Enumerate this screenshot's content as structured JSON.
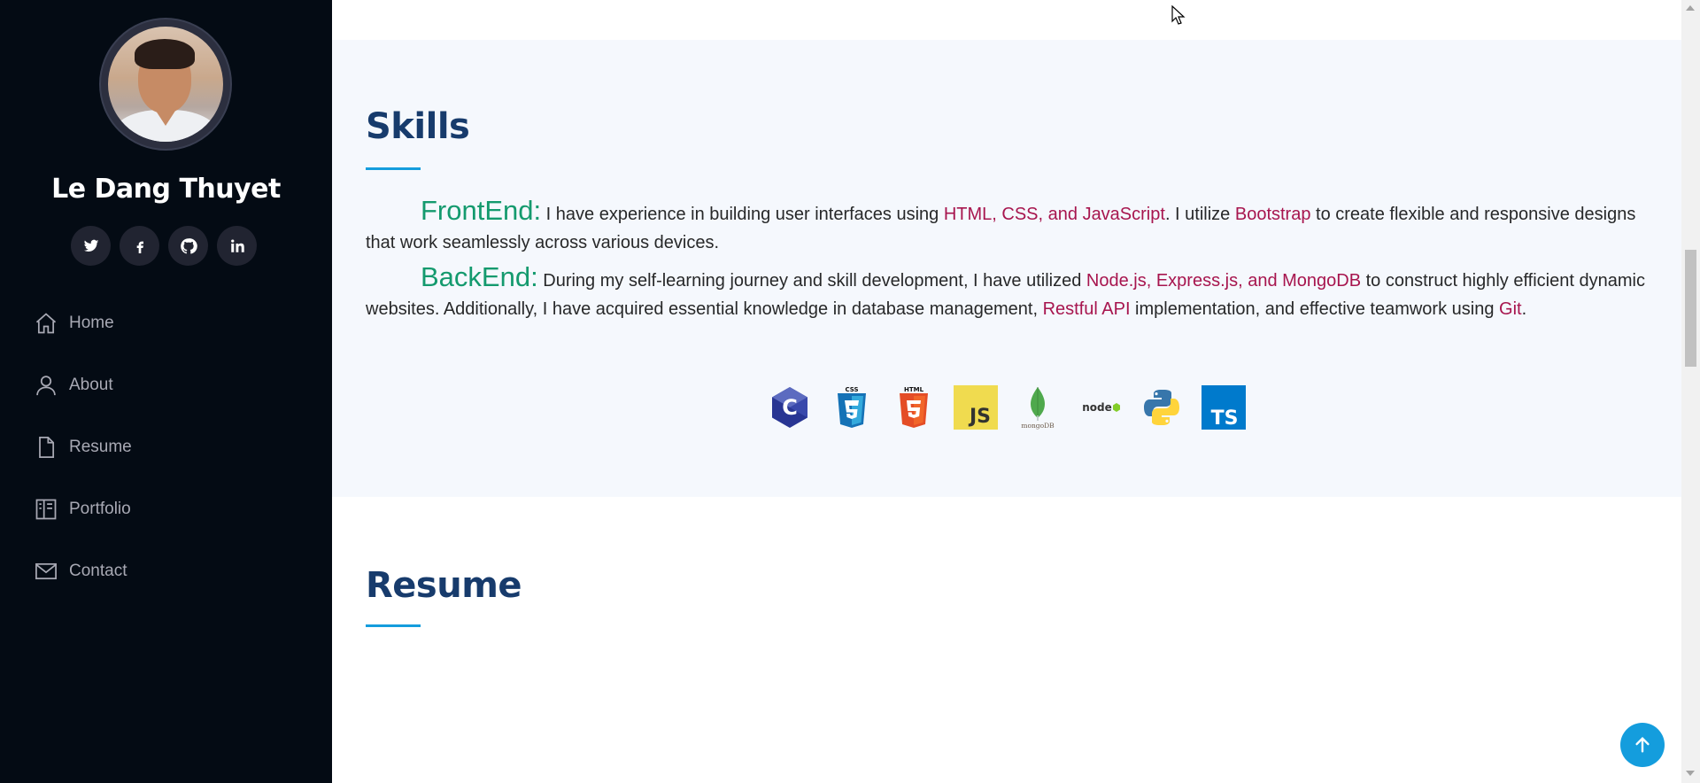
{
  "sidebar": {
    "name": "Le Dang Thuyet",
    "social": [
      {
        "icon": "twitter-icon",
        "glyph": "t"
      },
      {
        "icon": "facebook-icon",
        "glyph": "f"
      },
      {
        "icon": "github-icon",
        "glyph": "gh"
      },
      {
        "icon": "linkedin-icon",
        "glyph": "in"
      }
    ],
    "nav": [
      {
        "label": "Home",
        "icon": "home-icon"
      },
      {
        "label": "About",
        "icon": "person-icon"
      },
      {
        "label": "Resume",
        "icon": "file-icon"
      },
      {
        "label": "Portfolio",
        "icon": "book-icon"
      },
      {
        "label": "Contact",
        "icon": "envelope-icon"
      }
    ]
  },
  "skills": {
    "title": "Skills",
    "frontend": {
      "label": "FrontEnd:",
      "text1": " I have experience in building user interfaces using ",
      "hl1": "HTML, CSS, and JavaScript",
      "text2": ". I utilize ",
      "hl2": "Bootstrap",
      "text3": " to create flexible and responsive designs that work seamlessly across various devices."
    },
    "backend": {
      "label": "BackEnd:",
      "text1": " During my self-learning journey and skill development, I have utilized ",
      "hl1": "Node.js, Express.js, and MongoDB",
      "text2": " to construct highly efficient dynamic websites. Additionally, I have acquired essential knowledge in database management, ",
      "hl2": "Restful API",
      "text3": " implementation, and effective teamwork using ",
      "hl3": "Git",
      "text4": "."
    },
    "tech_icons": [
      {
        "name": "c-icon",
        "text": "C"
      },
      {
        "name": "css3-icon",
        "text": "CSS"
      },
      {
        "name": "html5-icon",
        "text": "HTML"
      },
      {
        "name": "javascript-icon",
        "text": "JS"
      },
      {
        "name": "mongodb-icon",
        "text": "mongoDB"
      },
      {
        "name": "nodejs-icon",
        "text": "node"
      },
      {
        "name": "python-icon",
        "text": ""
      },
      {
        "name": "typescript-icon",
        "text": "TS"
      }
    ]
  },
  "resume": {
    "title": "Resume"
  },
  "colors": {
    "accent": "#149ddd",
    "heading": "#173b6c",
    "highlight": "#a7154e",
    "label": "#149a6e",
    "sidebar_bg": "#040b14"
  }
}
